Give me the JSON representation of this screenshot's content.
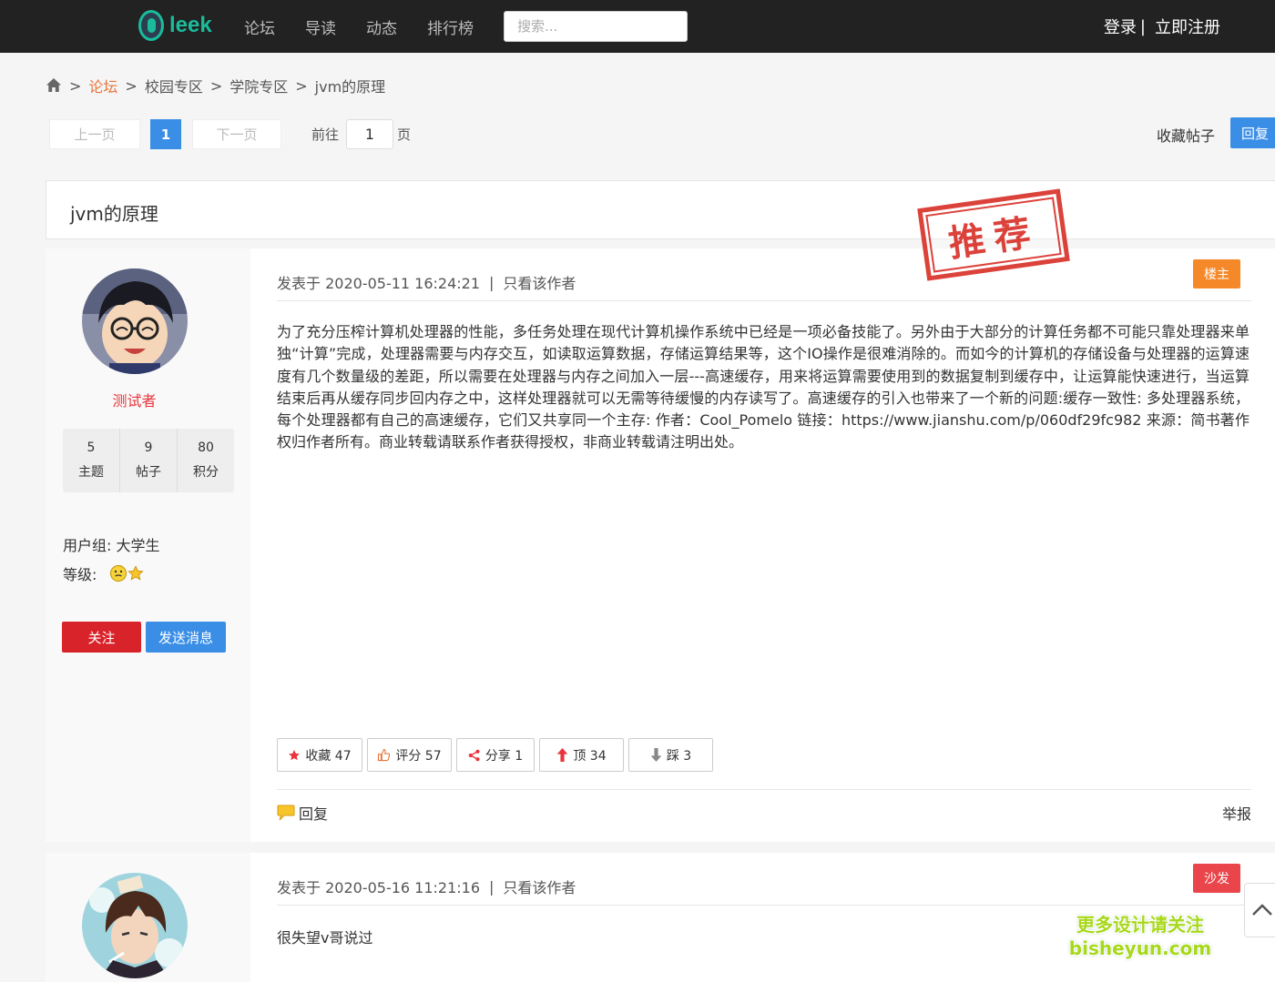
{
  "navbar": {
    "logo_text": "leek",
    "links": [
      "论坛",
      "导读",
      "动态",
      "排行榜"
    ],
    "search_placeholder": "搜索...",
    "login": "登录",
    "separator": "|",
    "register": "立即注册"
  },
  "breadcrumb": {
    "sep": ">",
    "items": [
      "论坛",
      "校园专区",
      "学院专区",
      "jvm的原理"
    ]
  },
  "pager": {
    "prev": "上一页",
    "current": "1",
    "next": "下一页",
    "goto_label": "前往",
    "goto_value": "1",
    "goto_suffix": "页",
    "favorite": "收藏帖子",
    "reply": "回复"
  },
  "thread": {
    "title": "jvm的原理",
    "stamp": "推荐"
  },
  "post1": {
    "username": "测试者",
    "stats": [
      {
        "value": "5",
        "label": "主题"
      },
      {
        "value": "9",
        "label": "帖子"
      },
      {
        "value": "80",
        "label": "积分"
      }
    ],
    "group_label": "用户组:",
    "group_value": "大学生",
    "level_label": "等级:",
    "follow": "关注",
    "message": "发送消息",
    "posted_at": "发表于 2020-05-11 16:24:21",
    "bar": "|",
    "author_only": "只看该作者",
    "floor": "楼主",
    "content": "为了充分压榨计算机处理器的性能，多任务处理在现代计算机操作系统中已经是一项必备技能了。另外由于大部分的计算任务都不可能只靠处理器来单独“计算”完成，处理器需要与内存交互，如读取运算数据，存储运算结果等，这个IO操作是很难消除的。而如今的计算机的存储设备与处理器的运算速度有几个数量级的差距，所以需要在处理器与内存之间加入一层---高速缓存，用来将运算需要使用到的数据复制到缓存中，让运算能快速进行，当运算结束后再从缓存同步回内存之中，这样处理器就可以无需等待缓慢的内存读写了。高速缓存的引入也带来了一个新的问题:缓存一致性: 多处理器系统，每个处理器都有自己的高速缓存，它们又共享同一个主存: 作者：Cool_Pomelo 链接：https://www.jianshu.com/p/060df29fc982 来源：简书著作权归作者所有。商业转载请联系作者获得授权，非商业转载请注明出处。",
    "actions": {
      "favorite": "收藏 47",
      "rate": "评分 57",
      "share": "分享 1",
      "up": "顶 34",
      "down": "踩 3"
    },
    "reply": "回复",
    "report": "举报"
  },
  "post2": {
    "posted_at": "发表于 2020-05-16 11:21:16",
    "bar": "|",
    "author_only": "只看该作者",
    "floor": "沙发",
    "content": "很失望v哥说过"
  },
  "watermark": {
    "line1": "更多设计请关注",
    "line2": "bisheyun.com"
  },
  "colors": {
    "accent_blue": "#3a8ee6",
    "accent_orange": "#e8743b",
    "danger_red": "#d9232a",
    "logo_green": "#1abc9c"
  }
}
